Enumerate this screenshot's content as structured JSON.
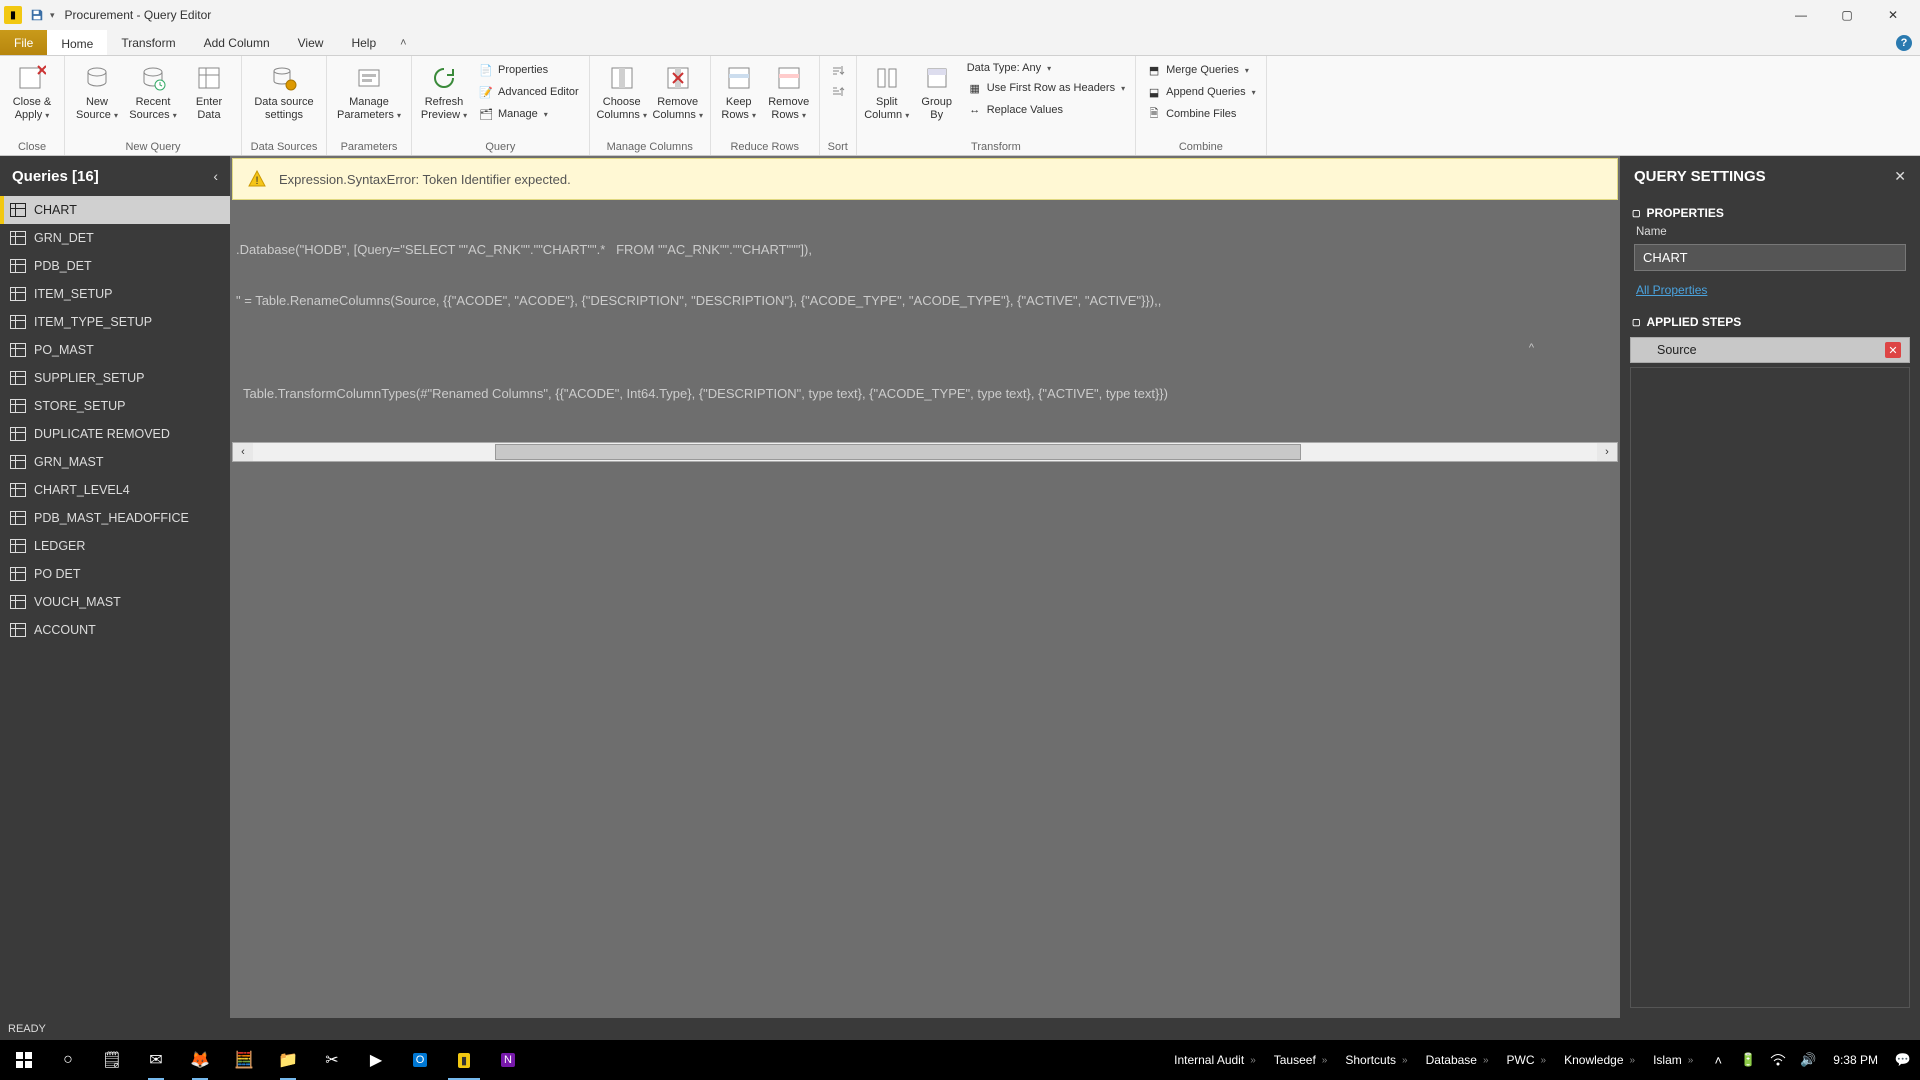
{
  "titlebar": {
    "title": "Procurement - Query Editor"
  },
  "tabs": {
    "file": "File",
    "home": "Home",
    "transform": "Transform",
    "addcolumn": "Add Column",
    "view": "View",
    "help": "Help"
  },
  "ribbon": {
    "close": {
      "close_apply": "Close &\nApply",
      "group": "Close"
    },
    "newquery": {
      "new_source": "New\nSource",
      "recent_sources": "Recent\nSources",
      "enter_data": "Enter\nData",
      "group": "New Query"
    },
    "datasources": {
      "settings": "Data source\nsettings",
      "group": "Data Sources"
    },
    "parameters": {
      "manage_params": "Manage\nParameters",
      "group": "Parameters"
    },
    "query": {
      "refresh": "Refresh\nPreview",
      "properties": "Properties",
      "advanced": "Advanced Editor",
      "manage": "Manage",
      "group": "Query"
    },
    "managecolumns": {
      "choose": "Choose\nColumns",
      "remove": "Remove\nColumns",
      "group": "Manage Columns"
    },
    "reducerows": {
      "keep": "Keep\nRows",
      "remove": "Remove\nRows",
      "group": "Reduce Rows"
    },
    "sort": {
      "group": "Sort"
    },
    "transform": {
      "split": "Split\nColumn",
      "groupby": "Group\nBy",
      "datatype": "Data Type: Any",
      "firstrow": "Use First Row as Headers",
      "replace": "Replace Values",
      "group": "Transform"
    },
    "combine": {
      "merge": "Merge Queries",
      "append": "Append Queries",
      "combinefiles": "Combine Files",
      "group": "Combine"
    }
  },
  "queries": {
    "title": "Queries [16]",
    "items": [
      "CHART",
      "GRN_DET",
      "PDB_DET",
      "ITEM_SETUP",
      "ITEM_TYPE_SETUP",
      "PO_MAST",
      "SUPPLIER_SETUP",
      "STORE_SETUP",
      "DUPLICATE REMOVED",
      "GRN_MAST",
      "CHART_LEVEL4",
      "PDB_MAST_HEADOFFICE",
      "LEDGER",
      "PO DET",
      "VOUCH_MAST",
      "ACCOUNT"
    ],
    "selected": 0
  },
  "error": {
    "text": "Expression.SyntaxError: Token Identifier expected."
  },
  "code": {
    "line1": ".Database(\"HODB\", [Query=\"SELECT \"\"AC_RNK\"\".\"\"CHART\"\".*   FROM \"\"AC_RNK\"\".\"\"CHART\"\"\"]),",
    "line2": "\" = Table.RenameColumns(Source, {{\"ACODE\", \"ACODE\"}, {\"DESCRIPTION\", \"DESCRIPTION\"}, {\"ACODE_TYPE\", \"ACODE_TYPE\"}, {\"ACTIVE\", \"ACTIVE\"}}),,",
    "caret": "^",
    "line3": "  Table.TransformColumnTypes(#\"Renamed Columns\", {{\"ACODE\", Int64.Type}, {\"DESCRIPTION\", type text}, {\"ACODE_TYPE\", type text}, {\"ACTIVE\", type text}})"
  },
  "settings": {
    "title": "QUERY SETTINGS",
    "properties": "PROPERTIES",
    "name_label": "Name",
    "name_value": "CHART",
    "all_properties": "All Properties",
    "applied_steps": "APPLIED STEPS",
    "steps": [
      "Source"
    ]
  },
  "status": {
    "ready": "READY"
  },
  "taskbar": {
    "pins": [
      "Internal Audit",
      "Tauseef",
      "Shortcuts",
      "Database",
      "PWC",
      "Knowledge",
      "Islam"
    ],
    "time": "9:38 PM"
  }
}
